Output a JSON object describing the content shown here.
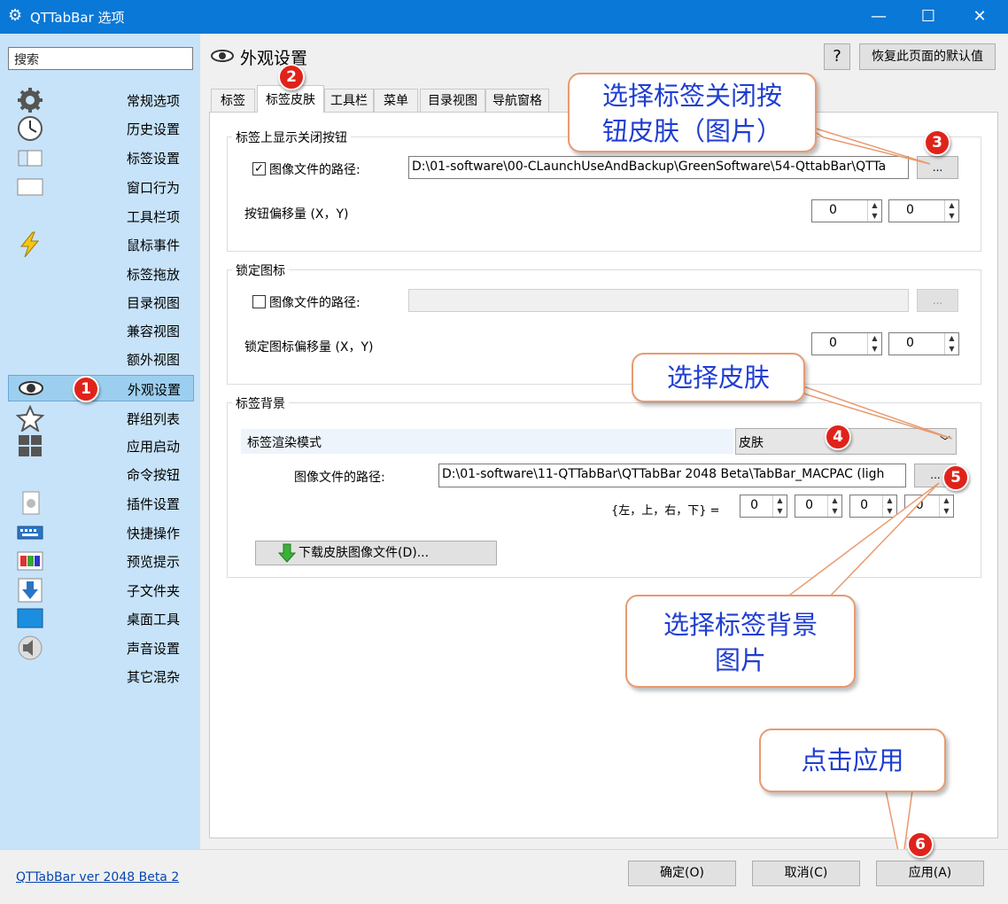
{
  "window": {
    "title": "QTTabBar 选项",
    "minimize": "—",
    "maximize": "☐",
    "close": "✕"
  },
  "sidebar": {
    "search_placeholder": "搜索",
    "items": [
      {
        "label": "常规选项",
        "icon": "gear-icon"
      },
      {
        "label": "历史设置",
        "icon": "clock-icon"
      },
      {
        "label": "标签设置",
        "icon": "tabs-icon"
      },
      {
        "label": "窗口行为",
        "icon": "window-icon"
      },
      {
        "label": "工具栏项",
        "icon": ""
      },
      {
        "label": "鼠标事件",
        "icon": "lightning-icon"
      },
      {
        "label": "标签拖放",
        "icon": ""
      },
      {
        "label": "目录视图",
        "icon": ""
      },
      {
        "label": "兼容视图",
        "icon": ""
      },
      {
        "label": "额外视图",
        "icon": ""
      },
      {
        "label": "外观设置",
        "icon": "eye-icon"
      },
      {
        "label": "群组列表",
        "icon": "star-icon"
      },
      {
        "label": "应用启动",
        "icon": "windows-logo-icon"
      },
      {
        "label": "命令按钮",
        "icon": ""
      },
      {
        "label": "插件设置",
        "icon": "plugin-icon"
      },
      {
        "label": "快捷操作",
        "icon": "keyboard-icon"
      },
      {
        "label": "预览提示",
        "icon": "preview-icon"
      },
      {
        "label": "子文件夹",
        "icon": "down-arrow-icon"
      },
      {
        "label": "桌面工具",
        "icon": "desktop-icon"
      },
      {
        "label": "声音设置",
        "icon": "speaker-icon"
      },
      {
        "label": "其它混杂",
        "icon": ""
      }
    ]
  },
  "main": {
    "title": "外观设置",
    "help_label": "?",
    "reset_label": "恢复此页面的默认值",
    "tabs": [
      "标签",
      "标签皮肤",
      "工具栏",
      "菜单",
      "目录视图",
      "导航窗格"
    ],
    "group1": {
      "title": "标签上显示关闭按钮",
      "checkbox_label": "图像文件的路径:",
      "checked": true,
      "path": "D:\\01-software\\00-CLaunchUseAndBackup\\GreenSoftware\\54-QttabBar\\QTTa",
      "browse_label": "...",
      "offset_label": "按钮偏移量 (X，Y)",
      "offset_x": "0",
      "offset_y": "0"
    },
    "group2": {
      "title": "锁定图标",
      "checkbox_label": "图像文件的路径:",
      "checked": false,
      "path": "",
      "browse_label": "...",
      "offset_label": "锁定图标偏移量 (X，Y)",
      "offset_x": "0",
      "offset_y": "0"
    },
    "group3": {
      "title": "标签背景",
      "render_mode_label": "标签渲染模式",
      "render_mode_value": "皮肤",
      "path_label": "图像文件的路径:",
      "path": "D:\\01-software\\11-QTTabBar\\QTTabBar 2048 Beta\\TabBar_MACPAC (ligh",
      "browse_label": "...",
      "margins_label": "{左，上，右，下} =",
      "margins": [
        "0",
        "0",
        "0",
        "0"
      ],
      "download_label": "下载皮肤图像文件(D)..."
    }
  },
  "footer": {
    "version": "QTTabBar ver 2048 Beta 2",
    "ok_label": "确定(O)",
    "cancel_label": "取消(C)",
    "apply_label": "应用(A)"
  },
  "annotations": {
    "callouts": [
      "选择标签关闭按钮皮肤（图片）",
      "选择皮肤",
      "选择标签背景图片",
      "点击应用"
    ],
    "callout1_line1": "选择标签关闭按",
    "callout1_line2": "钮皮肤（图片）",
    "callout3_line1": "选择标签背景",
    "callout3_line2": "图片",
    "badges": [
      "1",
      "2",
      "3",
      "4",
      "5",
      "6"
    ]
  }
}
